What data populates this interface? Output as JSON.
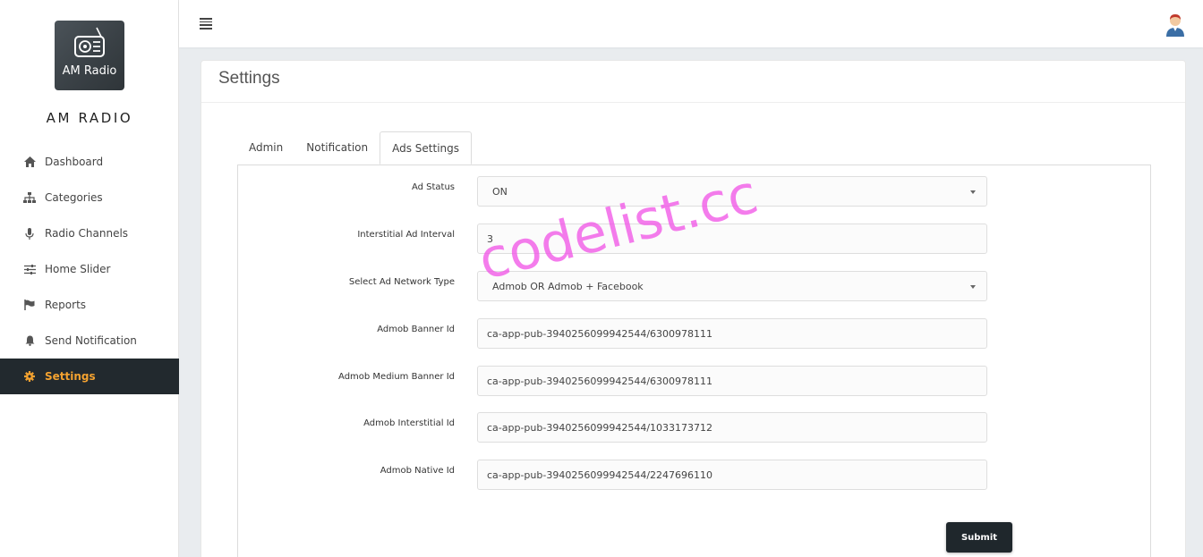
{
  "app": {
    "logo_text": "AM Radio",
    "brand_name": "AM RADIO"
  },
  "sidebar": {
    "items": [
      {
        "label": "Dashboard",
        "icon": "home-icon"
      },
      {
        "label": "Categories",
        "icon": "sitemap-icon"
      },
      {
        "label": "Radio Channels",
        "icon": "microphone-icon"
      },
      {
        "label": "Home Slider",
        "icon": "sliders-icon"
      },
      {
        "label": "Reports",
        "icon": "flag-icon"
      },
      {
        "label": "Send Notification",
        "icon": "bell-icon"
      },
      {
        "label": "Settings",
        "icon": "gear-icon",
        "active": true
      }
    ]
  },
  "page": {
    "title": "Settings",
    "tabs": [
      {
        "label": "Admin"
      },
      {
        "label": "Notification"
      },
      {
        "label": "Ads Settings",
        "active": true
      }
    ]
  },
  "form": {
    "ad_status": {
      "label": "Ad Status",
      "value": "ON"
    },
    "interstitial_interval": {
      "label": "Interstitial Ad Interval",
      "value": "3"
    },
    "ad_network_type": {
      "label": "Select Ad Network Type",
      "value": "Admob OR Admob + Facebook"
    },
    "admob_banner_id": {
      "label": "Admob Banner Id",
      "value": "ca-app-pub-3940256099942544/6300978111"
    },
    "admob_medium_banner_id": {
      "label": "Admob Medium Banner Id",
      "value": "ca-app-pub-3940256099942544/6300978111"
    },
    "admob_interstitial_id": {
      "label": "Admob Interstitial Id",
      "value": "ca-app-pub-3940256099942544/1033173712"
    },
    "admob_native_id": {
      "label": "Admob Native Id",
      "value": "ca-app-pub-3940256099942544/2247696110"
    },
    "submit_label": "Submit"
  },
  "watermark": "codelist.cc",
  "colors": {
    "sidebar_active_bg": "#22292e",
    "sidebar_active_text": "#f4a230",
    "submit_bg": "#1f272c"
  }
}
